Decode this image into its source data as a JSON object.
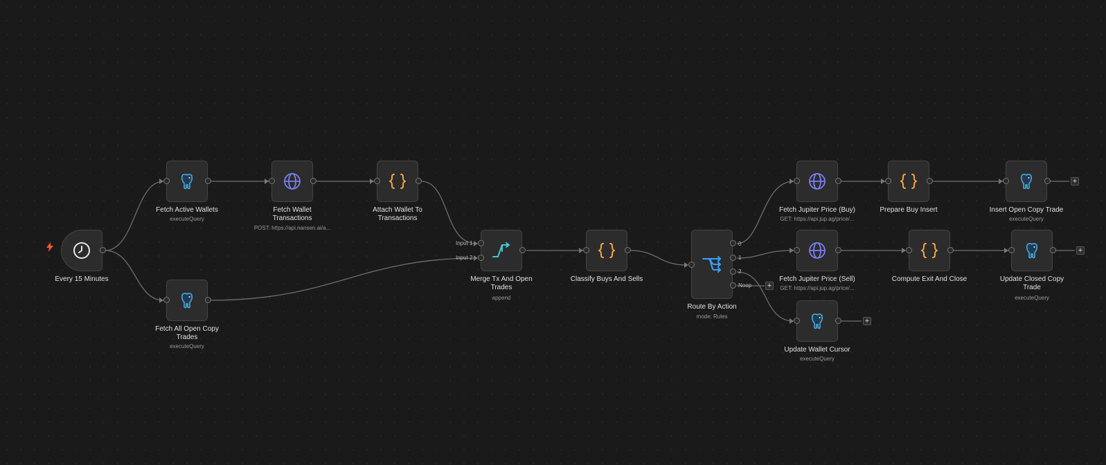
{
  "workflow": {
    "nodes": {
      "trigger": {
        "title": "Every 15 Minutes",
        "icon": "clock-icon"
      },
      "fetch_active_wallets": {
        "title": "Fetch Active Wallets",
        "subtitle": "executeQuery",
        "icon": "postgres-elephant-icon"
      },
      "fetch_all_open_copy_trades": {
        "title": "Fetch All Open Copy Trades",
        "subtitle": "executeQuery",
        "icon": "postgres-elephant-icon"
      },
      "fetch_wallet_transactions": {
        "title": "Fetch Wallet Transactions",
        "subtitle": "POST: https://api.nansen.ai/a...",
        "icon": "globe-icon"
      },
      "attach_wallet_to_transactions": {
        "title": "Attach Wallet To Transactions",
        "icon": "code-braces-icon"
      },
      "merge_tx_and_open_trades": {
        "title": "Merge Tx And Open Trades",
        "subtitle": "append",
        "icon": "merge-icon",
        "input_labels": [
          "Input 1",
          "Input 2"
        ]
      },
      "classify_buys_and_sells": {
        "title": "Classify Buys And Sells",
        "icon": "code-braces-icon"
      },
      "route_by_action": {
        "title": "Route By Action",
        "subtitle": "mode: Rules",
        "icon": "route-switch-icon",
        "output_labels": [
          "0",
          "1",
          "2",
          "Noop"
        ]
      },
      "fetch_jupiter_price_buy": {
        "title": "Fetch Jupiter Price (Buy)",
        "subtitle": "GET: https://api.jup.ag/price/...",
        "icon": "globe-icon"
      },
      "prepare_buy_insert": {
        "title": "Prepare Buy Insert",
        "icon": "code-braces-icon"
      },
      "insert_open_copy_trade": {
        "title": "Insert Open Copy Trade",
        "subtitle": "executeQuery",
        "icon": "postgres-elephant-icon"
      },
      "fetch_jupiter_price_sell": {
        "title": "Fetch Jupiter Price (Sell)",
        "subtitle": "GET: https://api.jup.ag/price/...",
        "icon": "globe-icon"
      },
      "compute_exit_and_close": {
        "title": "Compute Exit And Close",
        "icon": "code-braces-icon"
      },
      "update_closed_copy_trade": {
        "title": "Update Closed Copy Trade",
        "subtitle": "executeQuery",
        "icon": "postgres-elephant-icon"
      },
      "update_wallet_cursor": {
        "title": "Update Wallet Cursor",
        "subtitle": "executeQuery",
        "icon": "postgres-elephant-icon"
      }
    },
    "add_node_symbol": "+",
    "colors": {
      "globe": "#7b7ff0",
      "braces": "#f5a742",
      "merge": "#46c8d8",
      "router": "#3aa0ff",
      "postgres": "#4aa8dc",
      "trigger_bolt": "#ff5a2a",
      "edge": "#6f6f6f"
    }
  }
}
